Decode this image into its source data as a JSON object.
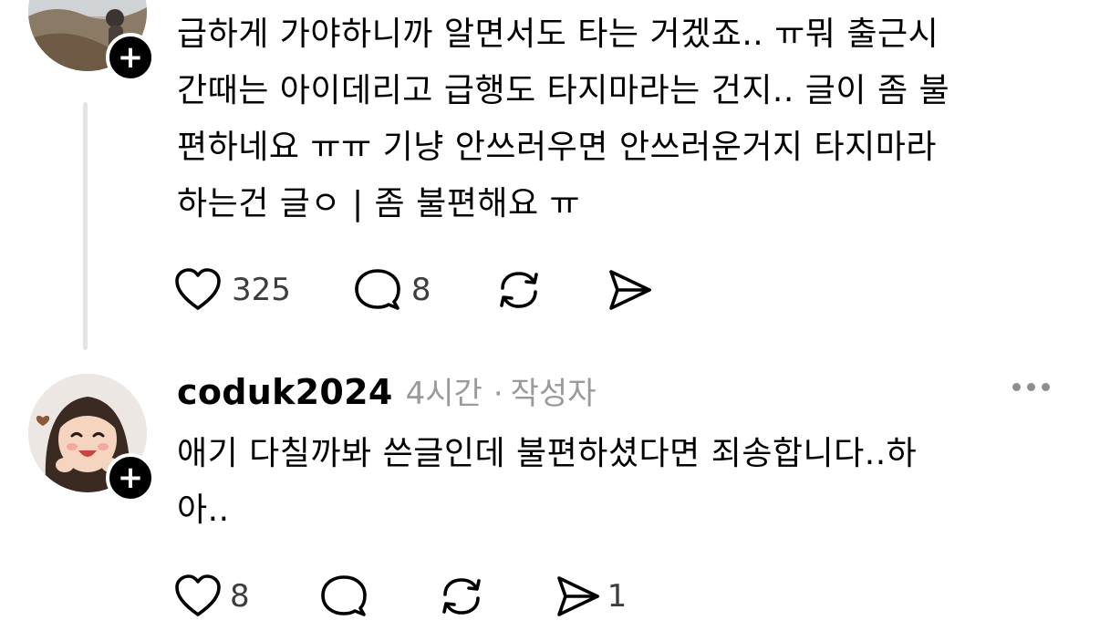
{
  "post1": {
    "text": "급하게 가야하니까 알면서도 타는 거겠죠.. ㅠ뭐 출근시\n간때는 아이데리고 급행도 타지마라는 건지.. 글이 좀 불\n편하네요 ㅠㅠ 기냥 안쓰러우면 안쓰러운거지 타지마라\n하는건 글ㅇ | 좀 불편해요 ㅠ",
    "likes": "325",
    "replies": "8",
    "follow_icon": "+"
  },
  "post2": {
    "username": "coduk2024",
    "time": "4시간",
    "separator": "·",
    "role": "작성자",
    "text": "애기 다칠까봐 쓴글인데 불편하셨다면 죄송합니다..하\n아..",
    "likes": "8",
    "shares": "1",
    "follow_icon": "+"
  },
  "colors": {
    "text": "#000000",
    "meta": "#9a9a9a",
    "count": "#3d3d3d",
    "thread_line": "#e3e3e3"
  },
  "icons": [
    "heart-icon",
    "comment-icon",
    "repost-icon",
    "share-icon",
    "more-icon",
    "plus-icon"
  ]
}
